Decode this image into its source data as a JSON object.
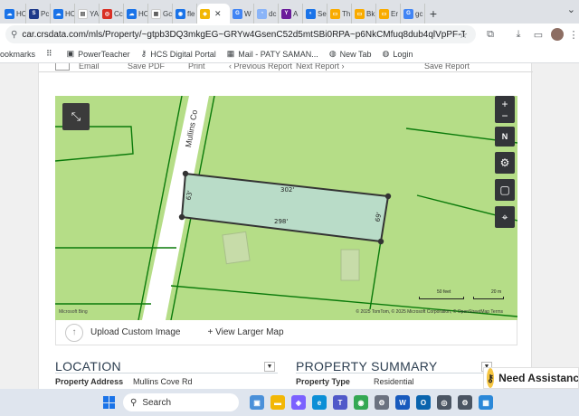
{
  "browser": {
    "tabs": [
      {
        "label": "HC",
        "color": "#1a73e8",
        "glyph": "☁"
      },
      {
        "label": "Pc",
        "color": "#1e3a8a",
        "glyph": "S"
      },
      {
        "label": "HC",
        "color": "#1a73e8",
        "glyph": "☁"
      },
      {
        "label": "YA",
        "color": "#ffffff",
        "glyph": "▤"
      },
      {
        "label": "Cc",
        "color": "#d93025",
        "glyph": "◎"
      },
      {
        "label": "HC",
        "color": "#1a73e8",
        "glyph": "☁"
      },
      {
        "label": "Gc",
        "color": "#ffffff",
        "glyph": "▦"
      },
      {
        "label": "fle",
        "color": "#1a73e8",
        "glyph": "◉"
      },
      {
        "label": "",
        "color": "#f2b705",
        "glyph": "◆",
        "active": true
      },
      {
        "label": "W",
        "color": "#4285f4",
        "glyph": "G"
      },
      {
        "label": "dc",
        "color": "#8ab4f8",
        "glyph": "◔"
      },
      {
        "label": "A",
        "color": "#6a1b9a",
        "glyph": "Y"
      },
      {
        "label": "Se",
        "color": "#1a73e8",
        "glyph": "◐"
      },
      {
        "label": "Th",
        "color": "#f9ab00",
        "glyph": "▭"
      },
      {
        "label": "Bk",
        "color": "#f9ab00",
        "glyph": "▭"
      },
      {
        "label": "Er",
        "color": "#f9ab00",
        "glyph": "▭"
      },
      {
        "label": "gc",
        "color": "#4285f4",
        "glyph": "G"
      }
    ],
    "new_tab": "+",
    "url": "car.crsdata.com/mls/Property/~gtpb3DQ3mkgEG~GRYw4GsenC52d5mtSBi0RPA~p6NkCMfuq8dub4qlVpPF-TGUHYun5e5dIG...",
    "bookmarks": [
      {
        "label": "ookmarks",
        "icon": "folder-icon"
      },
      {
        "label": "",
        "icon": "apps-icon"
      },
      {
        "label": "PowerTeacher",
        "icon": "powerteacher-icon"
      },
      {
        "label": "HCS Digital Portal",
        "icon": "key-icon"
      },
      {
        "label": "Mail - PATY SAMAN...",
        "icon": "mail-icon"
      },
      {
        "label": "New Tab",
        "icon": "globe-icon"
      },
      {
        "label": "Login",
        "icon": "login-icon"
      }
    ]
  },
  "report_bar": {
    "email": "Email",
    "save_pdf": "Save PDF",
    "print": "Print",
    "previous": "‹ Previous Report",
    "next": "Next Report ›",
    "save_report": "Save Report"
  },
  "map": {
    "road_label": "Mullins Co",
    "dims": {
      "top": "302'",
      "bottom": "298'",
      "left": "63'",
      "right": "69'"
    },
    "controls": [
      "+",
      "−",
      "N",
      "⚙",
      "▢",
      "⌖"
    ],
    "scale_feet": "50 feet",
    "scale_m": "20 m",
    "attribution": "© 2025 TomTom, © 2025 Microsoft Corporation, © OpenStreetMap   Terms",
    "logo": "Microsoft Bing",
    "parcel_fill": "#b9dcc8",
    "land_color": "#b5dd87",
    "road_color": "#ffffff",
    "boundary_color": "#0a7a0a"
  },
  "map_footer": {
    "upload_label": "Upload Custom Image",
    "view_larger": "+ View Larger Map"
  },
  "location": {
    "title": "LOCATION",
    "label": "Property Address",
    "value": "Mullins Cove Rd"
  },
  "summary": {
    "title": "PROPERTY SUMMARY",
    "label": "Property Type",
    "value": "Residential"
  },
  "help": {
    "label": "Need Assistance"
  },
  "taskbar": {
    "search_placeholder": "Search",
    "apps": [
      {
        "name": "widgets-app",
        "color": "#4a90d9",
        "glyph": "▣"
      },
      {
        "name": "file-explorer-app",
        "color": "#f2b705",
        "glyph": "▬"
      },
      {
        "name": "copilot-app",
        "color": "#7b61ff",
        "glyph": "◈"
      },
      {
        "name": "edge-app",
        "color": "#0c8fd6",
        "glyph": "e"
      },
      {
        "name": "teams-app",
        "color": "#5059c9",
        "glyph": "T"
      },
      {
        "name": "chrome-app",
        "color": "#34a853",
        "glyph": "◉"
      },
      {
        "name": "settings-app",
        "color": "#6b7280",
        "glyph": "⚙"
      },
      {
        "name": "word-app",
        "color": "#185abd",
        "glyph": "W"
      },
      {
        "name": "outlook-app",
        "color": "#0a64ad",
        "glyph": "O"
      },
      {
        "name": "camera-app",
        "color": "#4b5563",
        "glyph": "◎"
      },
      {
        "name": "gear-app",
        "color": "#4b5563",
        "glyph": "⚙"
      },
      {
        "name": "photos-app",
        "color": "#2b88d8",
        "glyph": "▦"
      }
    ]
  }
}
